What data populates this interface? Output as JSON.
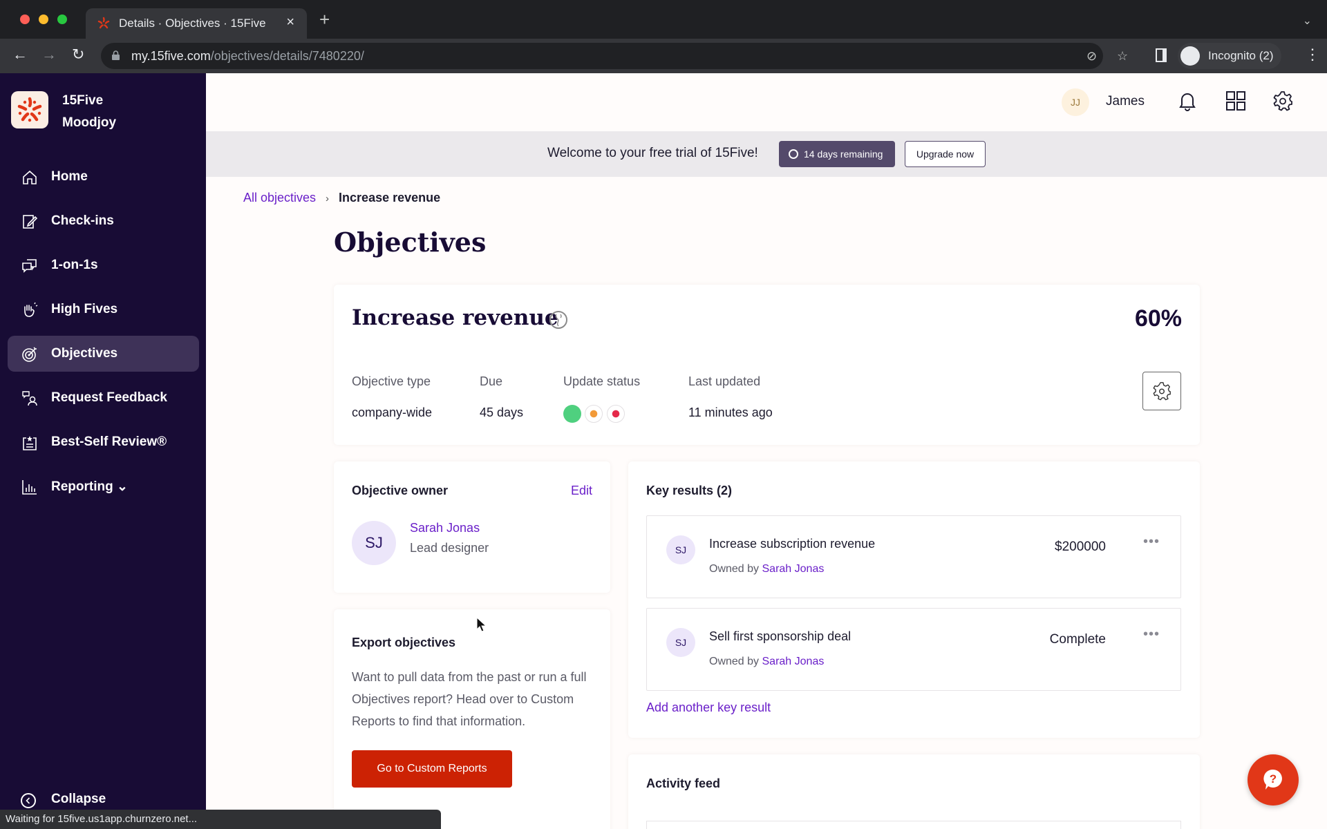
{
  "browser": {
    "tab_title": "Details · Objectives · 15Five",
    "url_host": "my.15five.com",
    "url_path": "/objectives/details/7480220/",
    "profile_label": "Incognito (2)",
    "status_text": "Waiting for 15five.us1app.churnzero.net..."
  },
  "brand": {
    "line1": "15Five",
    "line2": "Moodjoy",
    "accent": "#e13718"
  },
  "sidebar": {
    "items": [
      {
        "label": "Home",
        "icon": "home-icon"
      },
      {
        "label": "Check-ins",
        "icon": "check-ins-icon"
      },
      {
        "label": "1-on-1s",
        "icon": "chat-bubbles-icon"
      },
      {
        "label": "High Fives",
        "icon": "high-five-hand-icon"
      },
      {
        "label": "Objectives",
        "icon": "target-icon",
        "active": true
      },
      {
        "label": "Request Feedback",
        "icon": "feedback-person-icon"
      },
      {
        "label": "Best-Self Review®",
        "icon": "review-clipboard-icon"
      },
      {
        "label": "Reporting ⌄",
        "icon": "bar-chart-icon"
      }
    ],
    "collapse_label": "Collapse"
  },
  "topbar": {
    "user_initials": "JJ",
    "user_name": "James"
  },
  "trial": {
    "message": "Welcome to your free trial of 15Five!",
    "remaining": "14 days remaining",
    "upgrade_label": "Upgrade now"
  },
  "breadcrumb": {
    "parent": "All objectives",
    "current": "Increase revenue"
  },
  "page": {
    "title": "Objectives"
  },
  "objective": {
    "name": "Increase revenue",
    "progress_percent": "60%",
    "meta": [
      {
        "label": "Objective type",
        "value": "company-wide"
      },
      {
        "label": "Due",
        "value": "45 days"
      },
      {
        "label": "Update status",
        "value": ""
      },
      {
        "label": "Last updated",
        "value": "11 minutes ago"
      }
    ],
    "status_colors": {
      "on_track": "#4fd07f",
      "at_risk": "#f29a38",
      "off_track": "#e5294a"
    }
  },
  "owner": {
    "section_title": "Objective owner",
    "edit_label": "Edit",
    "initials": "SJ",
    "name": "Sarah Jonas",
    "role": "Lead designer"
  },
  "export": {
    "title": "Export objectives",
    "text": "Want to pull data from the past or run a full Objectives report? Head over to Custom Reports to find that information.",
    "button_label": "Go to Custom Reports"
  },
  "key_results": {
    "title": "Key results (2)",
    "items": [
      {
        "initials": "SJ",
        "title": "Increase subscription revenue",
        "owned_by": "Owned by",
        "owner": "Sarah Jonas",
        "value": "$200000"
      },
      {
        "initials": "SJ",
        "title": "Sell first sponsorship deal",
        "owned_by": "Owned by",
        "owner": "Sarah Jonas",
        "value": "Complete"
      }
    ],
    "add_label": "Add another key result"
  },
  "activity": {
    "title": "Activity feed"
  }
}
